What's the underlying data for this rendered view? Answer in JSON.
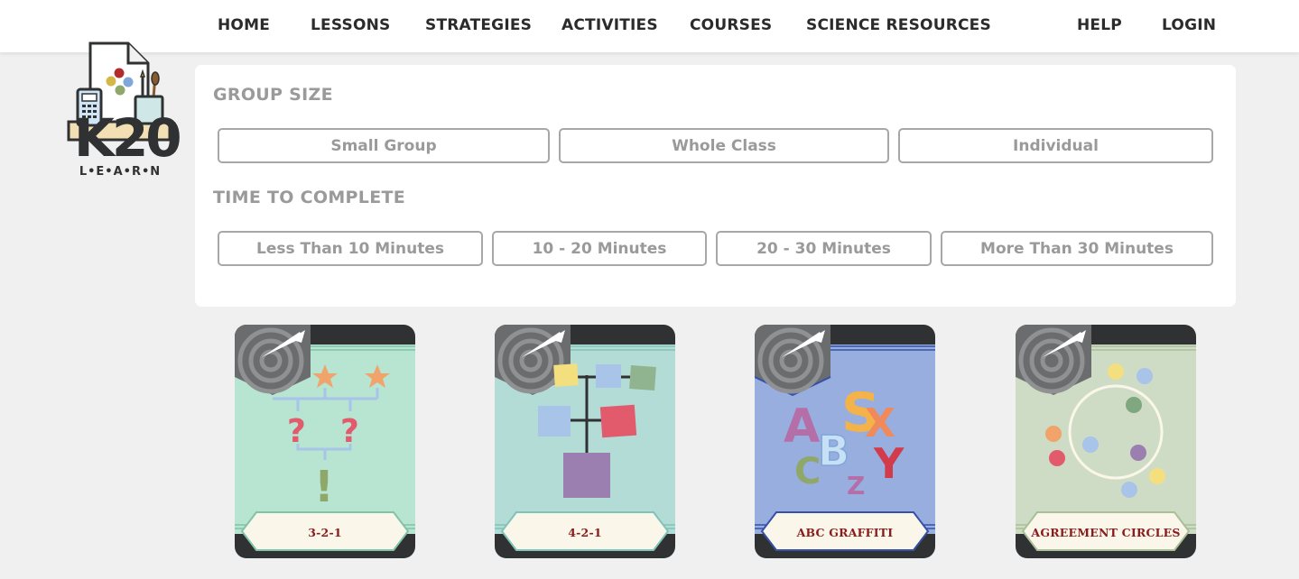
{
  "brand": {
    "wordmark": "K20",
    "tagline": "L•E•A•R•N"
  },
  "nav": {
    "items": [
      {
        "label": "HOME"
      },
      {
        "label": "LESSONS"
      },
      {
        "label": "STRATEGIES"
      },
      {
        "label": "ACTIVITIES"
      },
      {
        "label": "COURSES"
      },
      {
        "label": "SCIENCE RESOURCES"
      }
    ],
    "help": "HELP",
    "login": "LOGIN"
  },
  "filters": {
    "group_size": {
      "heading": "GROUP SIZE",
      "options": [
        "Small Group",
        "Whole Class",
        "Individual"
      ]
    },
    "time_to_complete": {
      "heading": "TIME TO COMPLETE",
      "options": [
        "Less Than 10 Minutes",
        "10 - 20 Minutes",
        "20 - 30 Minutes",
        "More Than 30 Minutes"
      ]
    }
  },
  "cards": [
    {
      "title": "3-2-1",
      "background": "#b8e4d2",
      "ribbon": "#7fc4a8",
      "illustration": "arrows-stars-question-marks-exclamation"
    },
    {
      "title": "4-2-1",
      "background": "#b3dcd6",
      "ribbon": "#7fc4b8",
      "illustration": "branching-squares-diagram"
    },
    {
      "title": "ABC GRAFFITI",
      "background": "#97aedf",
      "ribbon": "#3552a8",
      "illustration": "graffiti-letters"
    },
    {
      "title": "AGREEMENT CIRCLES",
      "background": "#cedcc5",
      "ribbon": "#a8bf98",
      "illustration": "circle-with-dots"
    }
  ],
  "colors": {
    "label_text": "#8b1a1a",
    "card_frame": "#2f3132",
    "filter_text": "#9a9a9a"
  }
}
